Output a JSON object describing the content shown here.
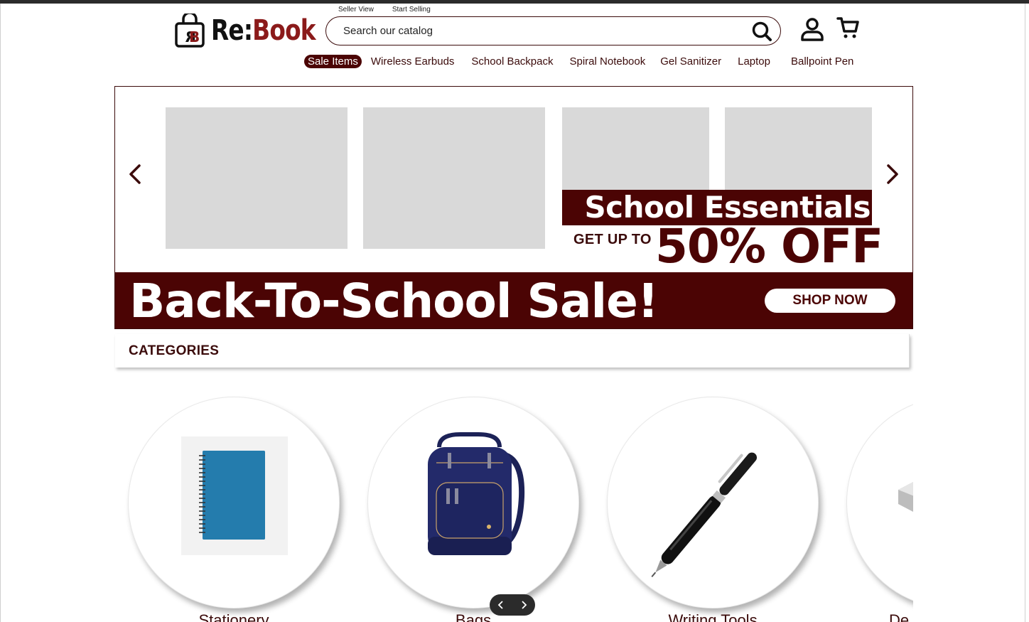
{
  "brand": {
    "re": "Re:",
    "book": "Book",
    "monogram": "RB"
  },
  "seller_links": {
    "seller_view": "Seller View",
    "start_selling": "Start Selling"
  },
  "search": {
    "placeholder": "Search our catalog"
  },
  "nav": {
    "sale": "Sale Items",
    "items": [
      "Wireless Earbuds",
      "School Backpack",
      "Spiral Notebook",
      "Gel Sanitizer",
      "Laptop",
      "Ballpoint Pen"
    ]
  },
  "banner": {
    "headline": "School Essentials",
    "get_up_to": "GET UP TO",
    "discount": "50% OFF",
    "sale_title": "Back-To-School Sale!",
    "cta": "SHOP NOW"
  },
  "categories": {
    "title": "CATEGORIES",
    "items": [
      {
        "label": "Stationery"
      },
      {
        "label": "Bags"
      },
      {
        "label": "Writing Tools"
      },
      {
        "label": "De"
      }
    ]
  },
  "colors": {
    "brand": "#4b0404",
    "placeholder": "#d9d9d9",
    "accent_red": "#8b1a1a"
  },
  "icons": [
    "search-icon",
    "user-icon",
    "cart-icon",
    "chevron-left-icon",
    "chevron-right-icon"
  ]
}
